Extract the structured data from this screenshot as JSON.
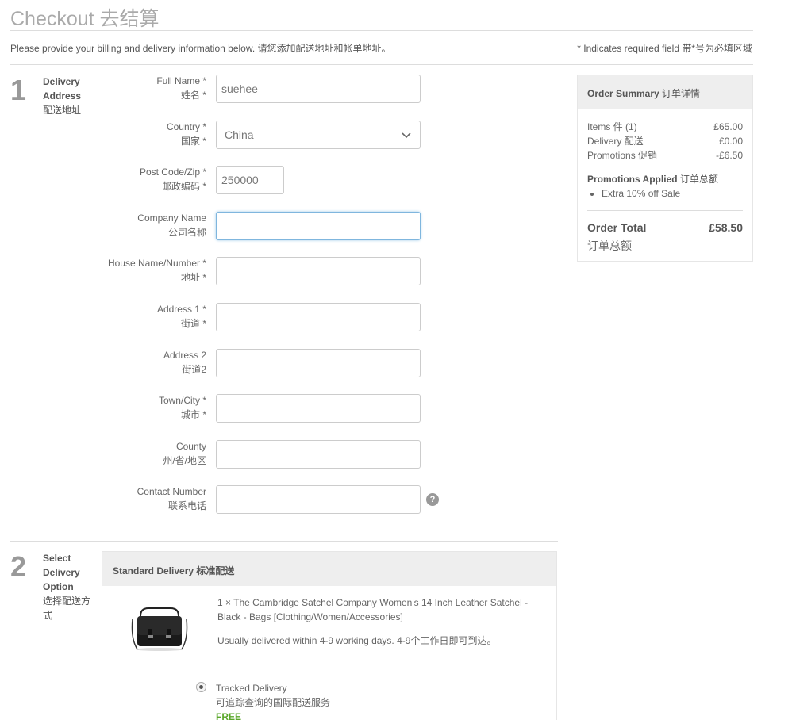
{
  "header": {
    "title": "Checkout 去结算",
    "intro": "Please provide your billing and delivery information below. 请您添加配送地址和帐单地址。",
    "required_note": "* Indicates required field 带*号为必填区域"
  },
  "step1": {
    "number": "1",
    "label_en_1": "Delivery",
    "label_en_2": "Address",
    "label_zh": "配送地址"
  },
  "form": {
    "full_name": {
      "label_en": "Full Name *",
      "label_zh": "姓名 *",
      "value": "suehee"
    },
    "country": {
      "label_en": "Country *",
      "label_zh": "国家 *",
      "value": "China"
    },
    "postcode": {
      "label_en": "Post Code/Zip *",
      "label_zh": "邮政编码 *",
      "value": "250000"
    },
    "company": {
      "label_en": "Company Name",
      "label_zh": "公司名称",
      "value": ""
    },
    "house": {
      "label_en": "House Name/Number *",
      "label_zh": "地址 *",
      "value": ""
    },
    "address1": {
      "label_en": "Address 1 *",
      "label_zh": "街道 *",
      "value": ""
    },
    "address2": {
      "label_en": "Address 2",
      "label_zh": "街道2",
      "value": ""
    },
    "town": {
      "label_en": "Town/City *",
      "label_zh": "城市 *",
      "value": ""
    },
    "county": {
      "label_en": "County",
      "label_zh": "州/省/地区",
      "value": ""
    },
    "contact": {
      "label_en": "Contact Number",
      "label_zh": "联系电话",
      "value": "",
      "help": "?"
    }
  },
  "summary": {
    "title_en": "Order Summary",
    "title_zh": "订单详情",
    "items_label": "Items 件 (1)",
    "items_value": "£65.00",
    "delivery_label": "Delivery 配送",
    "delivery_value": "£0.00",
    "promotions_label": "Promotions 促销",
    "promotions_value": "-£6.50",
    "promos_applied_en": "Promotions Applied",
    "promos_applied_zh": "订单总额",
    "promos": [
      "Extra 10% off Sale"
    ],
    "total_label": "Order Total",
    "total_value": "£58.50",
    "total_zh": "订单总额"
  },
  "step2": {
    "number": "2",
    "label_en_1": "Select",
    "label_en_2": "Delivery",
    "label_en_3": "Option",
    "label_zh": "选择配送方式"
  },
  "delivery": {
    "head": "Standard Delivery 标准配送",
    "product_name": "1 × The Cambridge Satchel Company Women's 14 Inch Leather Satchel - Black - Bags [Clothing/Women/Accessories]",
    "eta": "Usually delivered within 4-9 working days. 4-9个工作日即可到达。",
    "option_en": "Tracked Delivery",
    "option_zh": "可追踪查询的国际配送服务",
    "option_price": "FREE"
  }
}
